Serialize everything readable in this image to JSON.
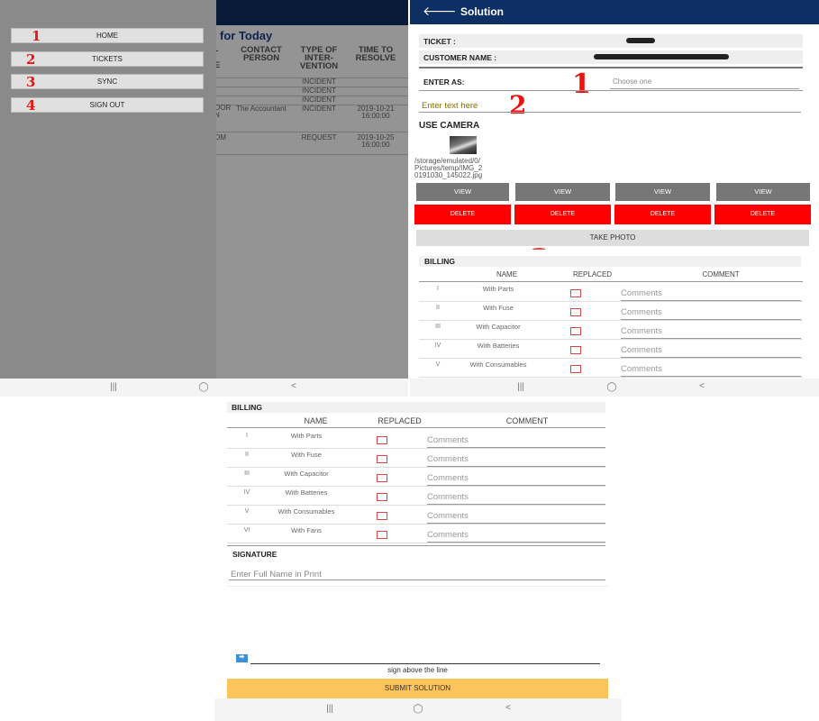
{
  "panel1": {
    "background_title": "for Today",
    "table_headers": [
      "CONTACT PERSON",
      "TYPE OF INTER-VENTION",
      "TIME TO RESOLVE"
    ],
    "header_fragment": "E",
    "rows": [
      {
        "type": "INCIDENT"
      },
      {
        "type": "INCIDENT"
      },
      {
        "type": "INCIDENT"
      },
      {
        "frag": "OOR\nN\nt",
        "contact": "The Accountant",
        "type": "INCIDENT",
        "time": "2019-10-21 16:00:00"
      },
      {
        "frag": "OM",
        "type": "REQUEST",
        "time": "2019-10-25 16:00:00"
      }
    ],
    "drawer_items": [
      {
        "num": "1",
        "label": "HOME"
      },
      {
        "num": "2",
        "label": "TICKETS"
      },
      {
        "num": "3",
        "label": "SYNC"
      },
      {
        "num": "4",
        "label": "SIGN OUT"
      }
    ]
  },
  "panel2": {
    "title": "Solution",
    "ticket_label": "TICKET :",
    "customer_label": "CUSTOMER NAME :",
    "enter_as_label": "ENTER AS:",
    "enter_as_placeholder": "Choose one",
    "annotation_1": "1",
    "annotation_2": "2",
    "text_placeholder": "Enter text here",
    "camera_label": "USE CAMERA",
    "image_path": "/storage/emulated/0/\nPictures/temp/IMG_2\n0191030_145022.jpg",
    "view_label": "VIEW",
    "delete_label": "DELETE",
    "take_photo_label": "TAKE PHOTO",
    "billing_label": "BILLING",
    "col_name": "NAME",
    "col_replaced": "REPLACED",
    "col_comment": "COMMENT",
    "comment_placeholder": "Comments",
    "billing_rows": [
      {
        "num": "I",
        "name": "With Parts"
      },
      {
        "num": "II",
        "name": "With Fuse"
      },
      {
        "num": "III",
        "name": "With Capacitor"
      },
      {
        "num": "IV",
        "name": "With Batteries"
      },
      {
        "num": "V",
        "name": "With Consumables"
      }
    ]
  },
  "panel3": {
    "billing_label": "BILLING",
    "col_name": "NAME",
    "col_replaced": "REPLACED",
    "col_comment": "COMMENT",
    "comment_placeholder": "Comments",
    "billing_rows": [
      {
        "num": "I",
        "name": "With Parts"
      },
      {
        "num": "II",
        "name": "With Fuse"
      },
      {
        "num": "III",
        "name": "With Capacitor"
      },
      {
        "num": "IV",
        "name": "With Batteries"
      },
      {
        "num": "V",
        "name": "With Consumables"
      },
      {
        "num": "VI",
        "name": "With Fans"
      }
    ],
    "signature_label": "SIGNATURE",
    "full_name_placeholder": "Enter Full Name in Print",
    "sign_caption": "sign above the line",
    "submit_label": "SUBMIT SOLUTION"
  },
  "nav": {
    "recents": "|||",
    "home": "◯",
    "back": "<"
  }
}
